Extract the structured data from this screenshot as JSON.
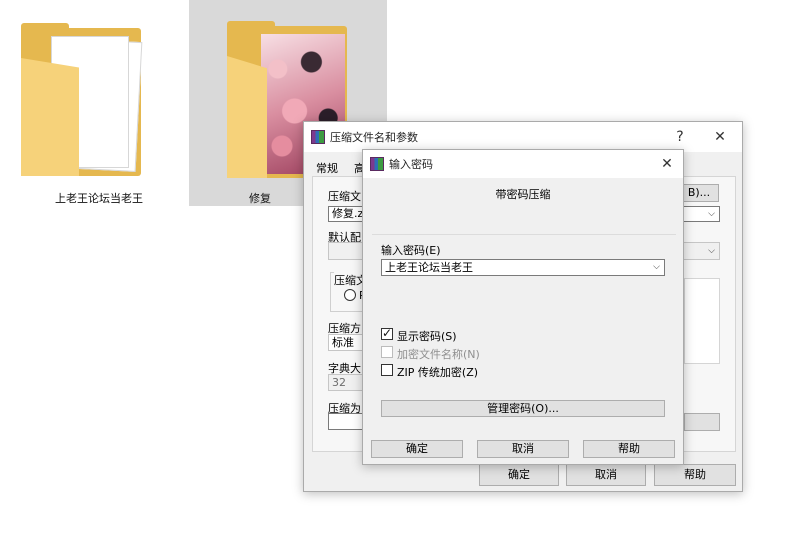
{
  "desktop": {
    "folders": [
      {
        "label": "上老王论坛当老王"
      },
      {
        "label": "修复"
      }
    ]
  },
  "archive_window": {
    "title": "压缩文件名和参数",
    "help_glyph": "?",
    "close_glyph": "✕",
    "tabs": [
      {
        "label": "常规"
      },
      {
        "label": "高"
      }
    ],
    "archive_name_label": "压缩文",
    "archive_name_value": "修复.z",
    "browse_button": "B)...",
    "default_profile_label": "默认配",
    "format_group_label": "压缩文",
    "format_radio_label": "R",
    "method_label": "压缩方",
    "method_value": "标准",
    "dictionary_label": "字典大",
    "dictionary_value": "32",
    "split_label": "压缩为",
    "ok_button": "确定",
    "cancel_button": "取消",
    "help_button": "帮助"
  },
  "password_dialog": {
    "title": "输入密码",
    "close_glyph": "✕",
    "heading": "带密码压缩",
    "password_label": "输入密码(E)",
    "password_value": "上老王论坛当老王",
    "show_password_label": "显示密码(S)",
    "encrypt_names_label": "加密文件名称(N)",
    "zip_legacy_label": "ZIP 传统加密(Z)",
    "manage_button": "管理密码(O)...",
    "ok_button": "确定",
    "cancel_button": "取消",
    "help_button": "帮助"
  },
  "colors": {
    "folder_yellow": "#f6d27a",
    "selection_gray": "#d9d9d9",
    "dialog_background": "#f0f0f0"
  }
}
